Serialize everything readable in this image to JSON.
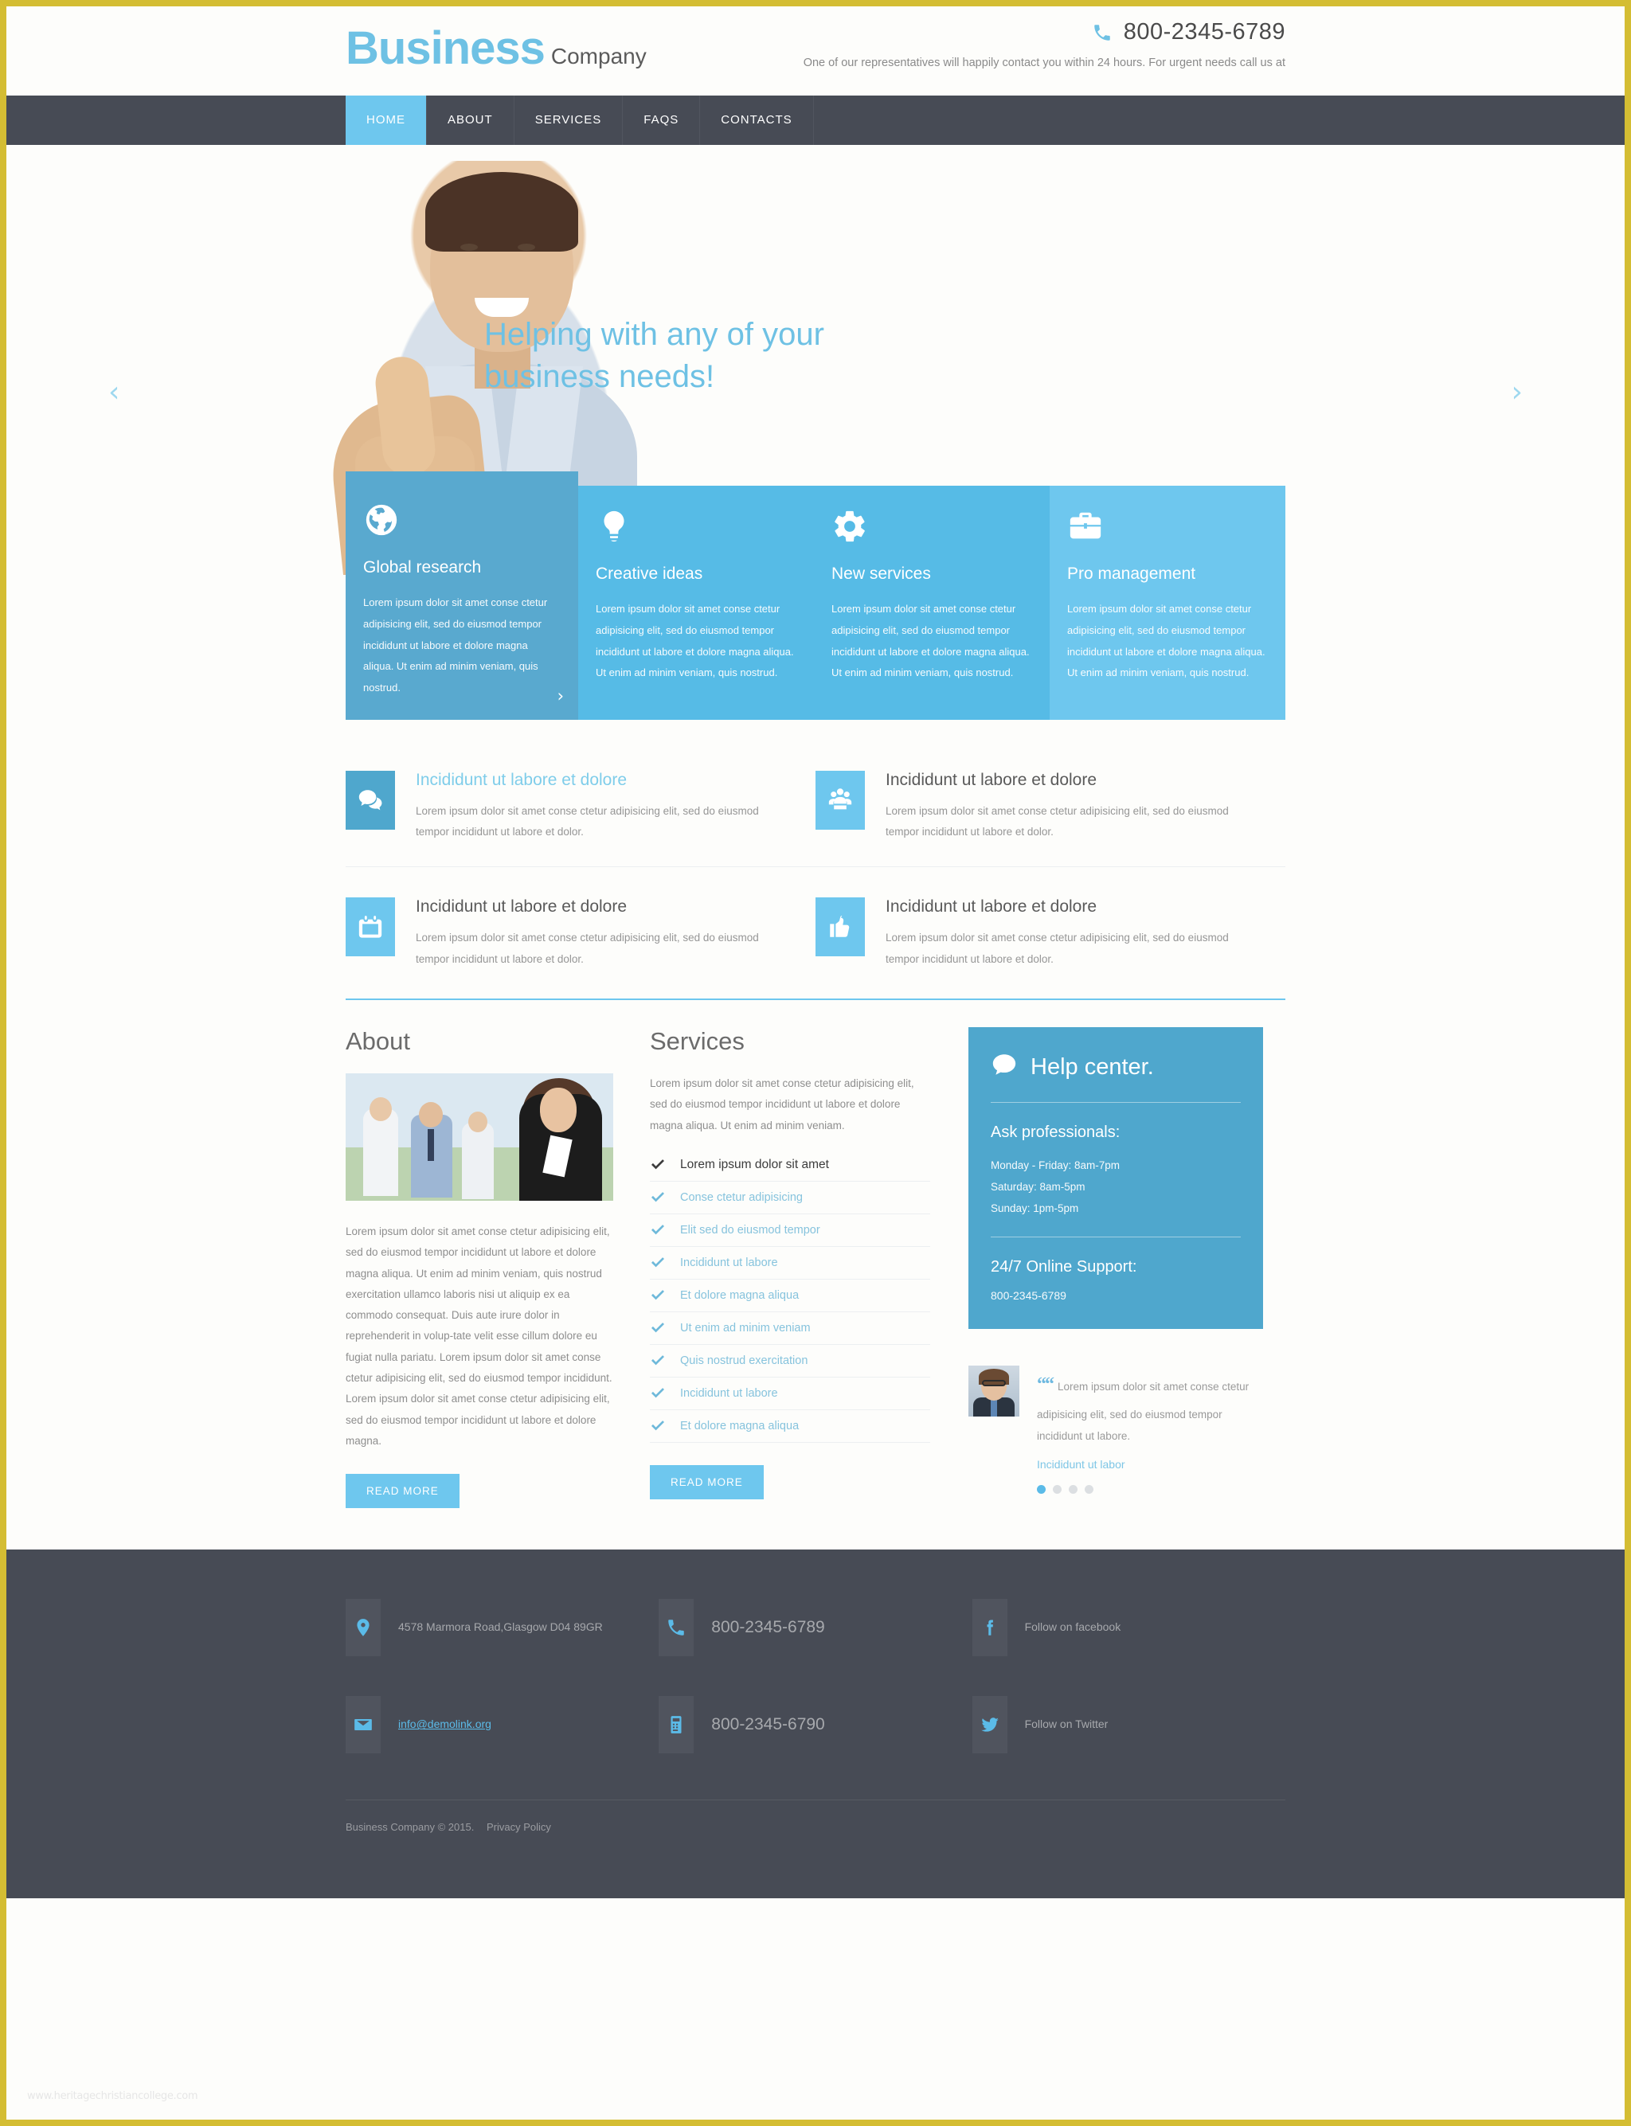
{
  "brand": {
    "name": "Business",
    "suffix": "Company"
  },
  "header": {
    "phone": "800-2345-6789",
    "note": "One of our representatives will happily contact you within 24 hours. For urgent needs call us at"
  },
  "nav": {
    "items": [
      "HOME",
      "ABOUT",
      "SERVICES",
      "FAQS",
      "CONTACTS"
    ]
  },
  "hero": {
    "title": "Helping with any of your business needs!",
    "prev": "‹",
    "next": "›"
  },
  "boxes": [
    {
      "icon": "globe-icon",
      "title": "Global research",
      "text": "Lorem ipsum dolor sit amet conse ctetur adipisicing elit, sed do eiusmod tempor incididunt ut labore et dolore magna aliqua. Ut enim ad minim veniam, quis nostrud.",
      "arrow": "›"
    },
    {
      "icon": "lightbulb-icon",
      "title": "Creative ideas",
      "text": "Lorem ipsum dolor sit amet conse ctetur adipisicing elit, sed do eiusmod tempor incididunt ut labore et dolore magna aliqua. Ut enim ad minim veniam, quis nostrud."
    },
    {
      "icon": "gear-icon",
      "title": "New services",
      "text": "Lorem ipsum dolor sit amet conse ctetur adipisicing elit, sed do eiusmod tempor incididunt ut labore et dolore magna aliqua. Ut enim ad minim veniam, quis nostrud."
    },
    {
      "icon": "briefcase-icon",
      "title": "Pro management",
      "text": "Lorem ipsum dolor sit amet conse ctetur adipisicing elit, sed do eiusmod tempor incididunt ut labore et dolore magna aliqua. Ut enim ad minim veniam, quis nostrud."
    }
  ],
  "features": [
    {
      "icon": "chat-bubble-icon",
      "title": "Incididunt ut labore et dolore",
      "text": "Lorem ipsum dolor sit amet conse ctetur adipisicing elit, sed do eiusmod tempor incididunt ut labore et dolor."
    },
    {
      "icon": "users-icon",
      "title": "Incididunt ut labore et dolore",
      "text": "Lorem ipsum dolor sit amet conse ctetur adipisicing elit, sed do eiusmod tempor incididunt ut labore et dolor."
    },
    {
      "icon": "calendar-icon",
      "title": "Incididunt ut labore et dolore",
      "text": "Lorem ipsum dolor sit amet conse ctetur adipisicing elit, sed do eiusmod tempor incididunt ut labore et dolor."
    },
    {
      "icon": "thumbs-up-icon",
      "title": "Incididunt ut labore et dolore",
      "text": "Lorem ipsum dolor sit amet conse ctetur adipisicing elit, sed do eiusmod tempor incididunt ut labore et dolor."
    }
  ],
  "about": {
    "title": "About",
    "text": "Lorem ipsum dolor sit amet conse ctetur adipisicing elit, sed do eiusmod tempor incididunt ut labore et dolore magna aliqua. Ut enim ad minim veniam, quis nostrud exercitation ullamco laboris nisi ut aliquip ex ea commodo consequat. Duis aute irure dolor in reprehenderit in volup-tate velit esse cillum dolore eu fugiat nulla pariatu. Lorem ipsum dolor sit amet conse ctetur adipisicing elit, sed do eiusmod tempor incididunt. Lorem ipsum dolor sit amet conse ctetur adipisicing elit, sed do eiusmod tempor incididunt ut labore et dolore magna.",
    "read_more": "READ MORE"
  },
  "services": {
    "title": "Services",
    "intro": "Lorem ipsum dolor sit amet conse ctetur adipisicing elit, sed do eiusmod tempor incididunt ut labore et dolore magna aliqua. Ut enim ad minim veniam.",
    "items": [
      "Lorem ipsum dolor sit amet",
      "Conse ctetur adipisicing",
      "Elit sed do eiusmod tempor",
      "Incididunt ut labore",
      "Et dolore magna aliqua",
      "Ut enim ad minim veniam",
      "Quis nostrud exercitation",
      "Incididunt ut labore",
      "Et dolore magna aliqua"
    ],
    "read_more": "READ MORE"
  },
  "help": {
    "title": "Help center.",
    "ask_title": "Ask professionals:",
    "hours": [
      "Monday - Friday: 8am-7pm",
      "Saturday: 8am-5pm",
      "Sunday: 1pm-5pm"
    ],
    "support_title": "24/7 Online Support:",
    "support_phone": "800-2345-6789"
  },
  "testimonial": {
    "quote_mark": "“",
    "text": "Lorem ipsum dolor sit amet conse ctetur adipisicing elit, sed do eiusmod tempor incididunt ut labore.",
    "author": "Incididunt ut labor",
    "dots": 4,
    "active_dot": 0
  },
  "footer": {
    "contacts": [
      {
        "icon": "map-pin-icon",
        "text": "4578 Marmora Road,Glasgow D04 89GR",
        "kind": "plain"
      },
      {
        "icon": "phone-icon",
        "text": "800-2345-6789",
        "kind": "big"
      },
      {
        "icon": "facebook-icon",
        "text": "Follow on facebook",
        "kind": "plain"
      },
      {
        "icon": "envelope-icon",
        "text": "info@demolink.org",
        "kind": "link"
      },
      {
        "icon": "fax-icon",
        "text": "800-2345-6790",
        "kind": "big"
      },
      {
        "icon": "twitter-icon",
        "text": "Follow on Twitter",
        "kind": "plain"
      }
    ],
    "copyright": "Business Company © 2015.",
    "privacy": "Privacy Policy",
    "watermark": "www.heritagechristiancollege.com"
  },
  "colors": {
    "accent": "#6ec7ee",
    "accent_dark": "#4fa7cd",
    "nav_bg": "#474b55",
    "page_border": "#d4bd33"
  }
}
